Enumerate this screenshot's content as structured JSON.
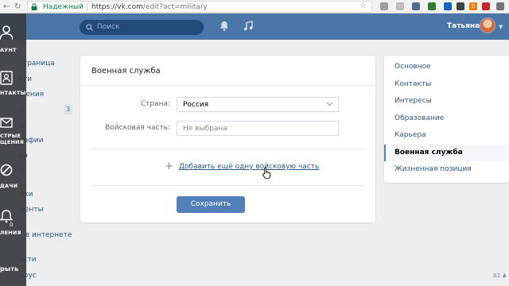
{
  "browser": {
    "secure_label": "Надежный",
    "url_host": "https://vk.com",
    "url_path": "/edit?act=military",
    "ext_badge": "0"
  },
  "header": {
    "search_placeholder": "Поиск",
    "username": "Татьяна"
  },
  "left_nav": {
    "items": [
      "страница",
      "сти",
      "щения",
      "я",
      "ы",
      "рафии",
      "ка",
      "о",
      "дки",
      "менты",
      "с в интернете",
      "ости",
      "ирус"
    ],
    "count": "3"
  },
  "overlay": {
    "labels": [
      "АУНТ",
      "НТАКТЫ",
      "СТРЫЕ ЩЕНИЯ",
      "ДАЧИ",
      "ЛЕНИЯ",
      "рыть"
    ],
    "badge": "0"
  },
  "card": {
    "title": "Военная служба",
    "country_label": "Страна:",
    "country_value": "Россия",
    "unit_label": "Войсковая часть:",
    "unit_placeholder": "Не выбрана",
    "add_link": "Добавить ещё одну войсковую часть",
    "save_button": "Сохранить"
  },
  "right_menu": {
    "items": [
      "Основное",
      "Контакты",
      "Интересы",
      "Образование",
      "Карьера",
      "Военная служба",
      "Жизненная позиция"
    ],
    "active_index": 5
  },
  "corner_text": "82",
  "colors": {
    "header_bg": "#4a76a8",
    "accent": "#5181b8",
    "link": "#2a5885",
    "page_bg": "#edeef0"
  }
}
